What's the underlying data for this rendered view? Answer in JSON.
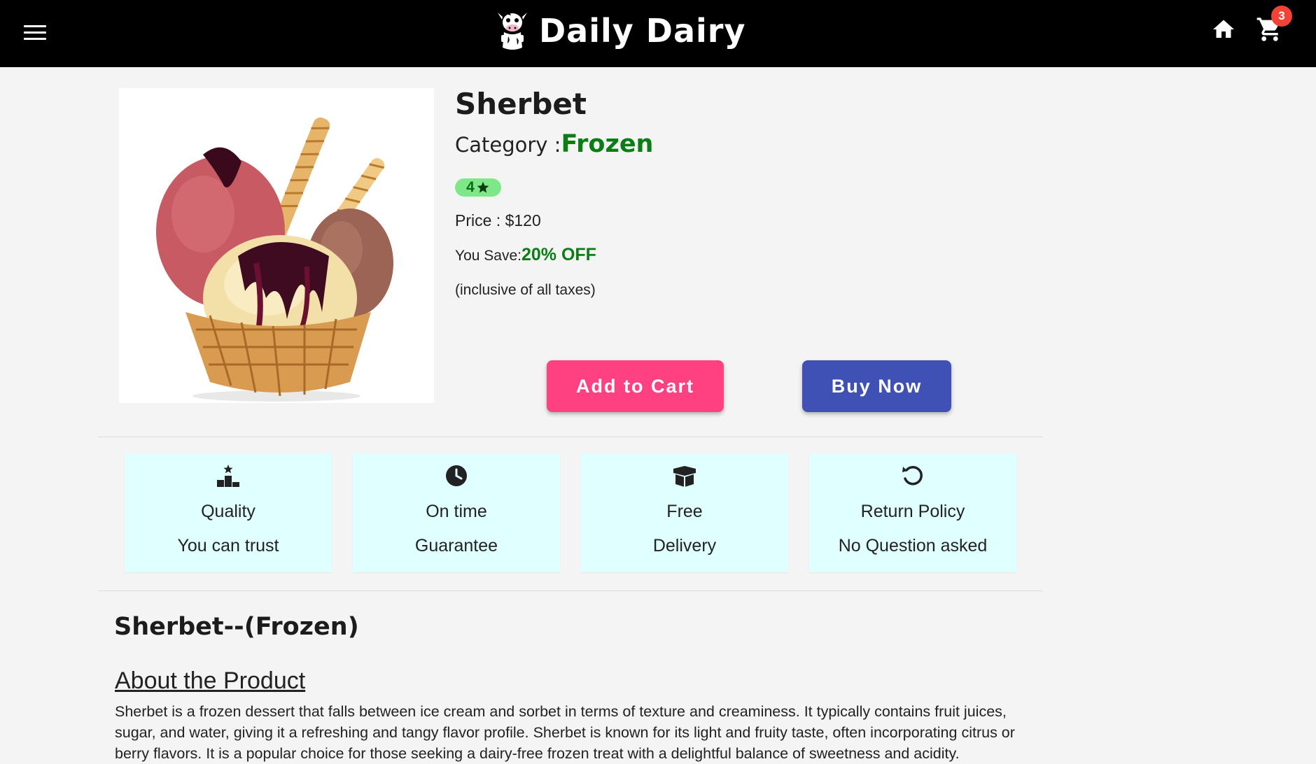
{
  "header": {
    "brand": "Daily Dairy",
    "cart_count": "3",
    "icons": [
      "menu-icon",
      "cow-logo-icon",
      "home-icon",
      "cart-icon"
    ]
  },
  "product": {
    "name": "Sherbet",
    "category_label": "Category :",
    "category": "Frozen",
    "rating": "4",
    "price_label": "Price : ",
    "price": "$120",
    "save_label": "You Save:",
    "discount": "20% OFF",
    "tax_note": "(inclusive of all taxes)",
    "image_alt": "ice cream sundae in a waffle cup"
  },
  "actions": {
    "add_to_cart": "Add to Cart",
    "buy_now": "Buy Now"
  },
  "features": [
    {
      "icon": "podium-icon",
      "line1": "Quality",
      "line2": "You can trust"
    },
    {
      "icon": "clock-icon",
      "line1": "On time",
      "line2": "Guarantee"
    },
    {
      "icon": "box-icon",
      "line1": "Free",
      "line2": "Delivery"
    },
    {
      "icon": "return-icon",
      "line1": "Return Policy",
      "line2": "No Question asked"
    }
  ],
  "description": {
    "heading": "Sherbet--(Frozen)",
    "about_heading": "About the Product",
    "about_text": "Sherbet is a frozen dessert that falls between ice cream and sorbet in terms of texture and creaminess. It typically contains fruit juices, sugar, and water, giving it a refreshing and tangy flavor profile. Sherbet is known for its light and fruity taste, often incorporating citrus or berry flavors. It is a popular choice for those seeking a dairy-free frozen treat with a delightful balance of sweetness and acidity."
  },
  "colors": {
    "header_bg": "#000000",
    "accent_green": "#0a7d14",
    "add_to_cart": "#ff4081",
    "buy_now": "#3f51b5",
    "feature_bg": "#e0ffff",
    "badge_red": "#f44336"
  }
}
